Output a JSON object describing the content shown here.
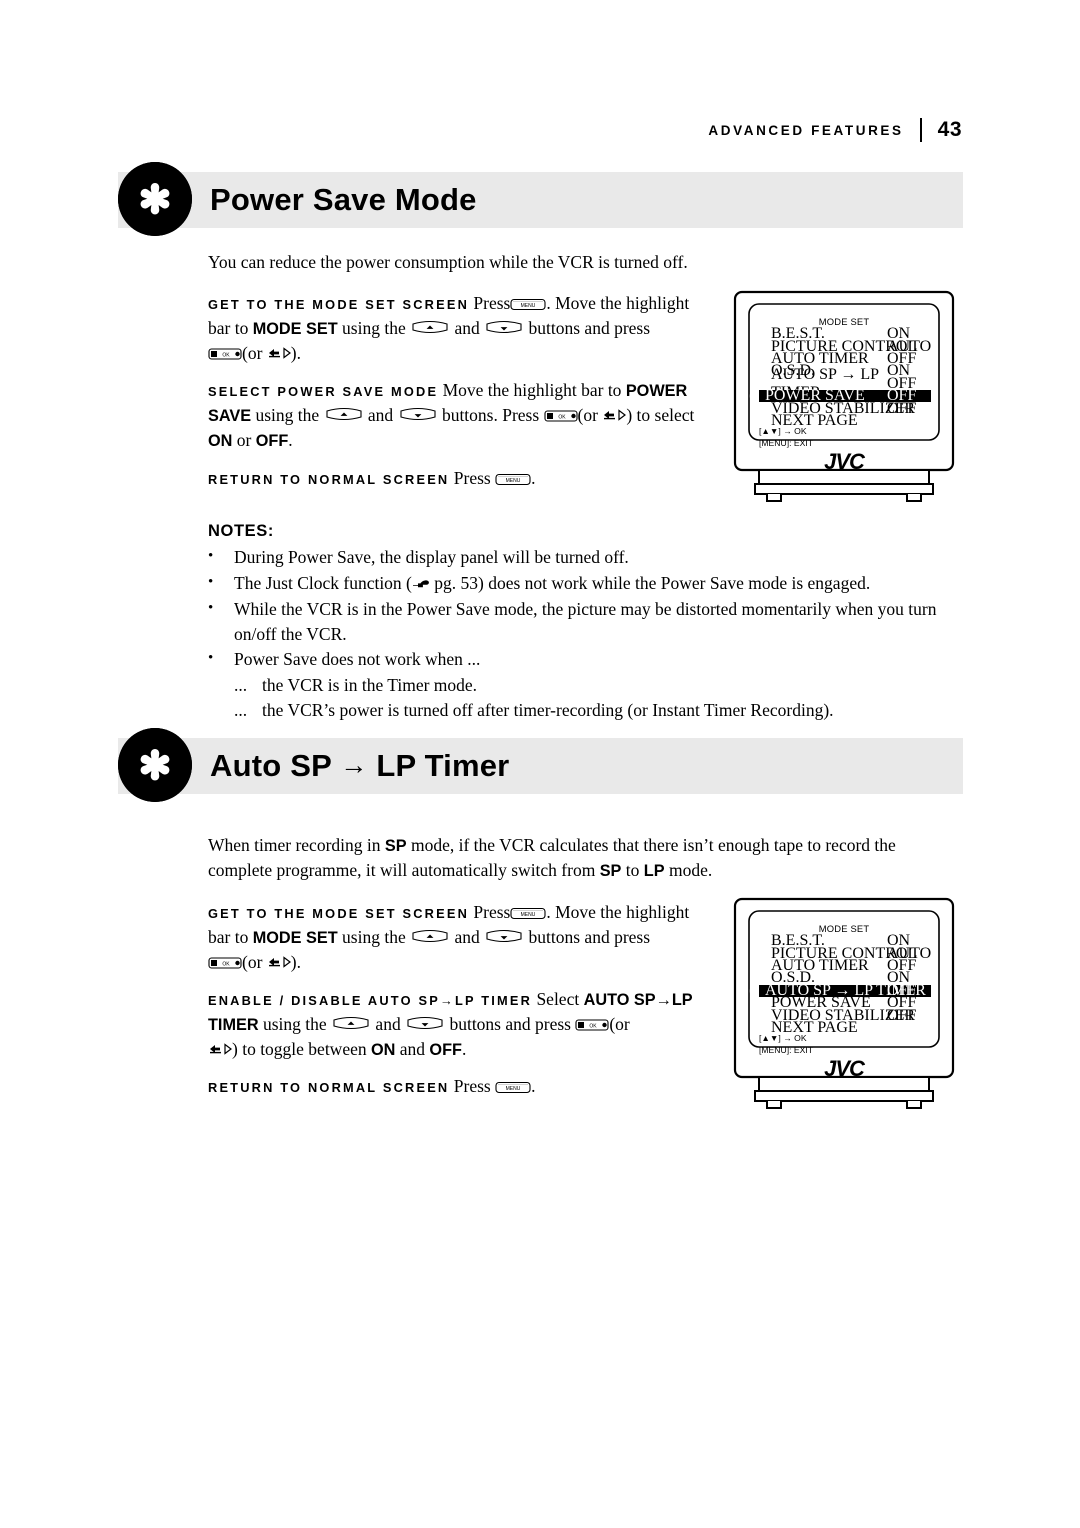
{
  "header": {
    "running_head": "ADVANCED FEATURES",
    "page_number": "43"
  },
  "sections": [
    {
      "id": "power-save",
      "title": "Power Save Mode",
      "intro": "You can reduce the power consumption while the VCR is turned off.",
      "steps": [
        {
          "label": "GET TO THE MODE SET SCREEN",
          "text_1": "Press",
          "text_2": ". Move the highlight bar to",
          "bold_1": "MODE SET",
          "text_3": "using the",
          "text_4": "and",
          "text_5": "buttons and press",
          "text_6": "(or",
          "text_7": ")."
        },
        {
          "label": "SELECT POWER SAVE MODE",
          "text_1": "Move the highlight bar to",
          "bold_1": "POWER SAVE",
          "text_2": "using the",
          "text_3": "and",
          "text_4": "buttons. Press",
          "text_5": "(or",
          "text_6": ") to select",
          "bold_2": "ON",
          "text_7": "or",
          "bold_3": "OFF",
          "text_8": "."
        },
        {
          "label": "RETURN TO NORMAL SCREEN",
          "text_1": "Press",
          "text_2": "."
        }
      ],
      "notes_title": "NOTES:",
      "notes": [
        {
          "bullet": "•",
          "text": "During Power Save, the display panel will be turned off."
        },
        {
          "bullet": "•",
          "text_a": "The Just Clock function (",
          "ref": "pg. 53",
          "text_b": ") does not work while the Power Save mode is engaged."
        },
        {
          "bullet": "•",
          "text": "While the VCR is in the Power Save mode, the picture may be distorted momentarily when you turn on/off the VCR."
        },
        {
          "bullet": "•",
          "text": "Power Save does not work when ..."
        }
      ],
      "sub_notes": [
        {
          "dots": "...",
          "text": "the VCR is in the Timer mode."
        },
        {
          "dots": "...",
          "text": "the VCR’s power is turned off after timer-recording (or Instant Timer Recording)."
        }
      ],
      "tv": {
        "osd_title": "MODE SET",
        "rows": [
          {
            "label": "B.E.S.T.",
            "value": "ON",
            "selected": false,
            "hand": false
          },
          {
            "label": "PICTURE CONTROL",
            "value": "AUTO",
            "selected": false,
            "hand": false
          },
          {
            "label": "AUTO TIMER",
            "value": "OFF",
            "selected": false,
            "hand": false
          },
          {
            "label": "O.S.D.",
            "value": "ON",
            "selected": false,
            "hand": false
          },
          {
            "label": "AUTO SP → LP TIMER",
            "value": "OFF",
            "selected": false,
            "hand": false
          },
          {
            "label": "POWER SAVE",
            "value": "OFF",
            "selected": true,
            "hand": true
          },
          {
            "label": "VIDEO STABILIZER",
            "value": "OFF",
            "selected": false,
            "hand": false
          },
          {
            "label": "NEXT PAGE",
            "value": "",
            "selected": false,
            "hand": false
          }
        ],
        "footer_1": "[▲▼] → OK",
        "footer_2": "[MENU]: EXIT",
        "brand": "JVC"
      }
    },
    {
      "id": "auto-sp-lp",
      "title_a": "Auto SP",
      "title_arrow": "→",
      "title_b": "LP Timer",
      "intro_a": "When timer recording in",
      "intro_bold_1": "SP",
      "intro_b": "mode, if the VCR calculates that there isn’t enough tape to record the complete programme, it will automatically switch from",
      "intro_bold_2": "SP",
      "intro_c": "to",
      "intro_bold_3": "LP",
      "intro_d": "mode.",
      "steps": [
        {
          "label": "GET TO THE MODE SET SCREEN",
          "text_1": "Press",
          "text_2": ". Move the highlight bar to",
          "bold_1": "MODE SET",
          "text_3": "using the",
          "text_4": "and",
          "text_5": "buttons and press",
          "text_6": "(or",
          "text_7": ")."
        },
        {
          "label": "ENABLE / DISABLE AUTO SP→LP TIMER",
          "text_1": "Select",
          "bold_1": "AUTO SP→LP TIMER",
          "text_2": "using the",
          "text_3": "and",
          "text_4": "buttons and press",
          "text_5": "(or",
          "text_6": ") to toggle between",
          "bold_2": "ON",
          "text_7": "and",
          "bold_3": "OFF",
          "text_8": "."
        },
        {
          "label": "RETURN TO NORMAL SCREEN",
          "text_1": "Press",
          "text_2": "."
        }
      ],
      "tv": {
        "osd_title": "MODE SET",
        "rows": [
          {
            "label": "B.E.S.T.",
            "value": "ON",
            "selected": false,
            "hand": false
          },
          {
            "label": "PICTURE CONTROL",
            "value": "AUTO",
            "selected": false,
            "hand": false
          },
          {
            "label": "AUTO TIMER",
            "value": "OFF",
            "selected": false,
            "hand": false
          },
          {
            "label": "O.S.D.",
            "value": "ON",
            "selected": false,
            "hand": false
          },
          {
            "label": "AUTO SP → LP TIMER",
            "value": "OFF",
            "selected": true,
            "hand": true
          },
          {
            "label": "POWER SAVE",
            "value": "OFF",
            "selected": false,
            "hand": false
          },
          {
            "label": "VIDEO STABILIZER",
            "value": "OFF",
            "selected": false,
            "hand": false
          },
          {
            "label": "NEXT PAGE",
            "value": "",
            "selected": false,
            "hand": false
          }
        ],
        "footer_1": "[▲▼] → OK",
        "footer_2": "[MENU]: EXIT",
        "brand": "JVC"
      }
    }
  ],
  "keys": {
    "menu": "MENU",
    "ok": "OK",
    "up": "▲",
    "down": "▼",
    "play": "▷"
  }
}
